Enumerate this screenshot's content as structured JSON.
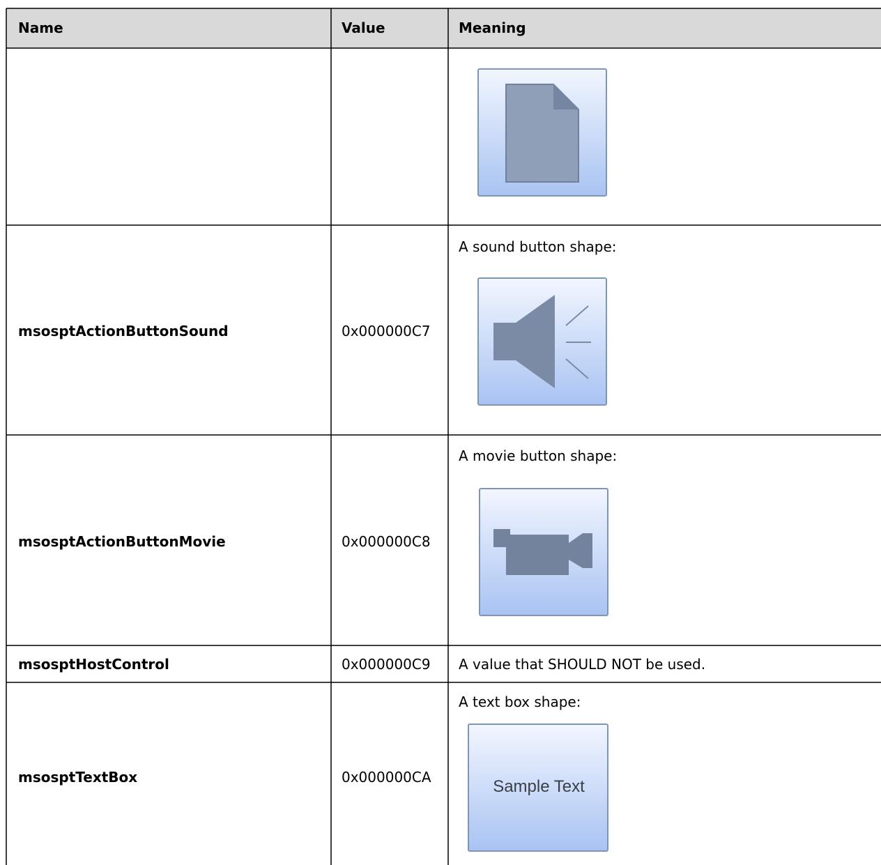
{
  "table": {
    "headers": {
      "name": "Name",
      "value": "Value",
      "meaning": "Meaning"
    },
    "rows": [
      {
        "name": "",
        "value": "",
        "meaning": "",
        "icon": "document-button-icon"
      },
      {
        "name": "msosptActionButtonSound",
        "value": "0x000000C7",
        "meaning": "A sound button shape:",
        "icon": "sound-speaker-icon"
      },
      {
        "name": "msosptActionButtonMovie",
        "value": "0x000000C8",
        "meaning": "A movie button shape:",
        "icon": "movie-camera-icon"
      },
      {
        "name": "msosptHostControl",
        "value": "0x000000C9",
        "meaning": "A value that SHOULD NOT be used.",
        "icon": ""
      },
      {
        "name": "msosptTextBox",
        "value": "0x000000CA",
        "meaning": "A text box shape:",
        "icon": "text-box-icon",
        "icon_text": "Sample Text"
      }
    ]
  }
}
